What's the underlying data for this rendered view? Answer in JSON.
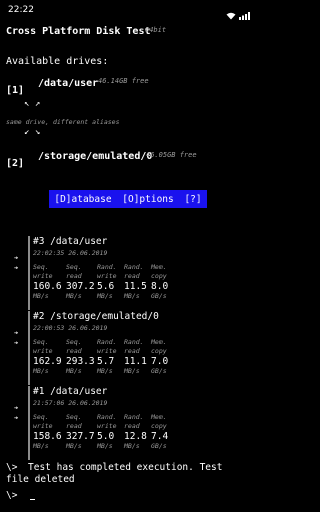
{
  "status_bar": {
    "time": "22:22",
    "icons": [
      "wifi-icon",
      "signal-icon"
    ]
  },
  "header": {
    "title": "Cross Platform Disk Test",
    "subtitle": "64bit"
  },
  "drives": {
    "label": "Available drives:",
    "items": [
      {
        "index": "[1]",
        "path": "/data/user",
        "free": "46.14GB free"
      },
      {
        "index": "[2]",
        "path": "/storage/emulated/0",
        "free": "46.05GB free"
      }
    ],
    "alias_arrows_top": "↖ ↗",
    "alias_note": "same drive, different aliases",
    "alias_arrows_bottom": "↙ ↘"
  },
  "menu": {
    "items": [
      {
        "label": "[D]atabase"
      },
      {
        "label": "[O]ptions"
      },
      {
        "label": "[?]"
      }
    ]
  },
  "results": {
    "column_headers": [
      {
        "line1": "Seq.",
        "line2": "write"
      },
      {
        "line1": "Seq.",
        "line2": "read"
      },
      {
        "line1": "Rand.",
        "line2": "write"
      },
      {
        "line1": "Rand.",
        "line2": "read"
      },
      {
        "line1": "Mem.",
        "line2": "copy"
      }
    ],
    "units": [
      "MB/s",
      "MB/s",
      "MB/s",
      "MB/s",
      "GB/s"
    ],
    "cards": [
      {
        "title": "#3 /data/user",
        "timestamp": "22:02:35 26.06.2019",
        "values": [
          "160.6",
          "307.2",
          "5.6",
          "11.5",
          "8.0"
        ]
      },
      {
        "title": "#2 /storage/emulated/0",
        "timestamp": "22:00:53 26.06.2019",
        "values": [
          "162.9",
          "293.3",
          "5.7",
          "11.1",
          "7.0"
        ]
      },
      {
        "title": "#1 /data/user",
        "timestamp": "21:57:06 26.06.2019",
        "values": [
          "158.6",
          "327.7",
          "5.0",
          "12.8",
          "7.4"
        ]
      }
    ]
  },
  "console": {
    "prompt": "\\>",
    "message": "Test has completed execution. Test file deleted",
    "input_value": ""
  },
  "colors": {
    "background": "#000000",
    "menu_bar": "#1a12ee",
    "muted_text": "#9a9a9a",
    "card_bar": "#8c8c8c"
  }
}
